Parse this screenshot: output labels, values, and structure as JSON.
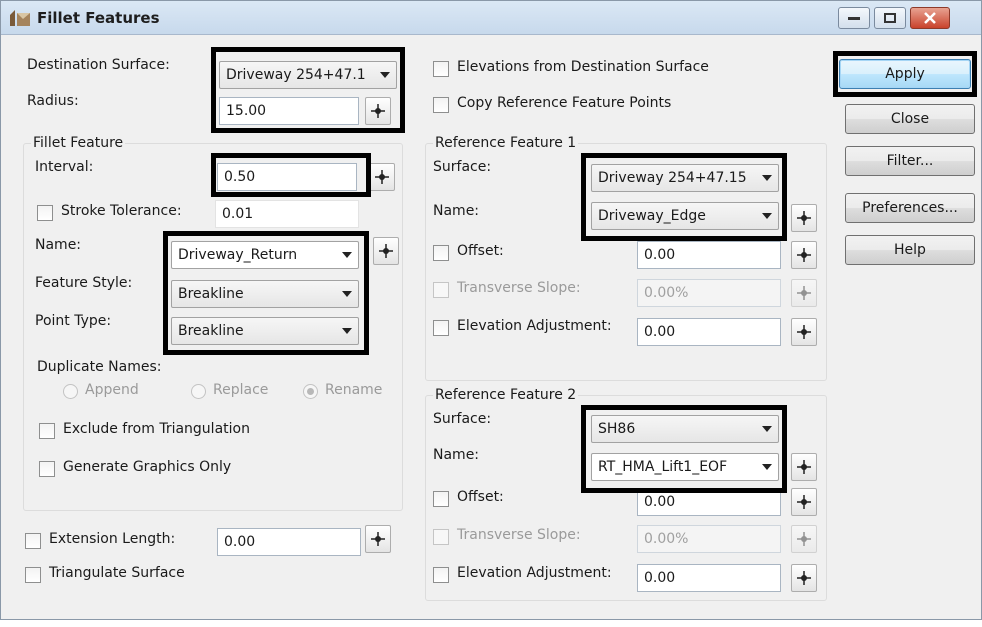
{
  "window": {
    "title": "Fillet Features"
  },
  "left": {
    "destination_surface_label": "Destination Surface:",
    "destination_surface_value": "Driveway 254+47.1",
    "radius_label": "Radius:",
    "radius_value": "15.00",
    "fillet_group_title": "Fillet Feature",
    "interval_label": "Interval:",
    "interval_value": "0.50",
    "stroke_tolerance_label": "Stroke Tolerance:",
    "stroke_tolerance_value": "0.01",
    "name_label": "Name:",
    "name_value": "Driveway_Return",
    "feature_style_label": "Feature Style:",
    "feature_style_value": "Breakline",
    "point_type_label": "Point Type:",
    "point_type_value": "Breakline",
    "duplicate_names_label": "Duplicate Names:",
    "radio_append": "Append",
    "radio_replace": "Replace",
    "radio_rename": "Rename",
    "exclude_triangulation_label": "Exclude from Triangulation",
    "generate_graphics_label": "Generate Graphics Only",
    "extension_length_label": "Extension Length:",
    "extension_length_value": "0.00",
    "triangulate_surface_label": "Triangulate Surface"
  },
  "middle": {
    "elevations_from_dest_label": "Elevations from Destination Surface",
    "copy_ref_points_label": "Copy Reference Feature Points",
    "ref1": {
      "title": "Reference Feature 1",
      "surface_label": "Surface:",
      "surface_value": "Driveway 254+47.15",
      "name_label": "Name:",
      "name_value": "Driveway_Edge",
      "offset_label": "Offset:",
      "offset_value": "0.00",
      "transverse_label": "Transverse Slope:",
      "transverse_value": "0.00%",
      "elev_adj_label": "Elevation Adjustment:",
      "elev_adj_value": "0.00"
    },
    "ref2": {
      "title": "Reference Feature 2",
      "surface_label": "Surface:",
      "surface_value": "SH86",
      "name_label": "Name:",
      "name_value": "RT_HMA_Lift1_EOF",
      "offset_label": "Offset:",
      "offset_value": "0.00",
      "transverse_label": "Transverse Slope:",
      "transverse_value": "0.00%",
      "elev_adj_label": "Elevation Adjustment:",
      "elev_adj_value": "0.00"
    }
  },
  "buttons": {
    "apply": "Apply",
    "close": "Close",
    "filter": "Filter...",
    "preferences": "Preferences...",
    "help": "Help"
  },
  "colors": {
    "highlight": "#000000",
    "dialog_bg": "#f0f0f0"
  }
}
